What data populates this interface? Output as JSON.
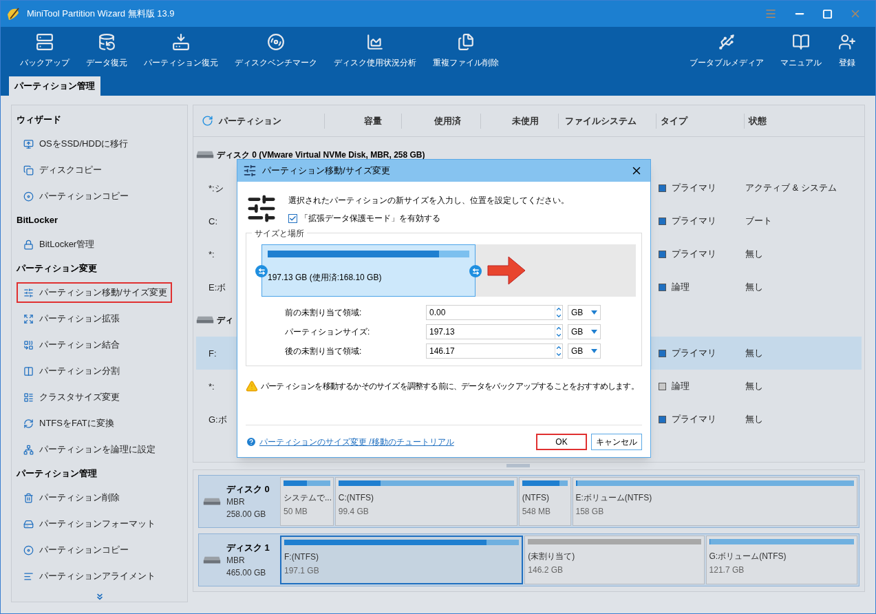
{
  "window": {
    "title": "MiniTool Partition Wizard 無料版 13.9"
  },
  "toolbar": {
    "left": [
      "バックアップ",
      "データ復元",
      "パーティション復元",
      "ディスクベンチマーク",
      "ディスク使用状況分析",
      "重複ファイル削除"
    ],
    "right": [
      "ブータブルメディア",
      "マニュアル",
      "登録"
    ]
  },
  "tabs": [
    {
      "label": "パーティション管理",
      "selected": true
    }
  ],
  "sidebar": {
    "sections": [
      {
        "title": "ウィザード",
        "items": [
          {
            "label": "OSをSSD/HDDに移行",
            "selected": false
          },
          {
            "label": "ディスクコピー",
            "selected": false
          },
          {
            "label": "パーティションコピー",
            "selected": false
          }
        ]
      },
      {
        "title": "BitLocker",
        "items": [
          {
            "label": "BitLocker管理",
            "selected": false
          }
        ]
      },
      {
        "title": "パーティション変更",
        "items": [
          {
            "label": "パーティション移動/サイズ変更",
            "selected": true
          },
          {
            "label": "パーティション拡張",
            "selected": false
          },
          {
            "label": "パーティション結合",
            "selected": false
          },
          {
            "label": "パーティション分割",
            "selected": false
          },
          {
            "label": "クラスタサイズ変更",
            "selected": false
          },
          {
            "label": "NTFSをFATに変換",
            "selected": false
          },
          {
            "label": "パーティションを論理に設定",
            "selected": false
          }
        ]
      },
      {
        "title": "パーティション管理",
        "items": [
          {
            "label": "パーティション削除",
            "selected": false
          },
          {
            "label": "パーティションフォーマット",
            "selected": false
          },
          {
            "label": "パーティションコピー",
            "selected": false
          },
          {
            "label": "パーティションアライメント",
            "selected": false
          }
        ]
      }
    ]
  },
  "table": {
    "columns": [
      "パーティション",
      "容量",
      "使用済",
      "未使用",
      "ファイルシステム",
      "タイプ",
      "状態"
    ],
    "groups": [
      {
        "disk": "ディスク 0 (VMware Virtual NVMe Disk, MBR, 258 GB)",
        "rows": [
          {
            "partition": "*:シ",
            "type": "プライマリ",
            "color": "#1f6fc0",
            "status": "アクティブ & システム",
            "selected": false
          },
          {
            "partition": "C:",
            "type": "プライマリ",
            "color": "#1f6fc0",
            "status": "ブート",
            "selected": false
          },
          {
            "partition": "*:",
            "type": "プライマリ",
            "color": "#1f6fc0",
            "status": "無し",
            "selected": false
          },
          {
            "partition": "E:ボ",
            "type": "論理",
            "color": "#1f6fc0",
            "status": "無し",
            "selected": false
          }
        ]
      },
      {
        "disk": "ディ",
        "rows": [
          {
            "partition": "F:",
            "type": "プライマリ",
            "color": "#1f6fc0",
            "status": "無し",
            "selected": true
          },
          {
            "partition": "*:",
            "type": "論理",
            "color": "#c8c8c8",
            "status": "無し",
            "selected": false
          },
          {
            "partition": "G:ボ",
            "type": "プライマリ",
            "color": "#1f6fc0",
            "status": "無し",
            "selected": false
          }
        ]
      }
    ]
  },
  "disk_map": [
    {
      "name": "ディスク 0",
      "scheme": "MBR",
      "size": "258.00 GB",
      "partitions": [
        {
          "kind": "partition",
          "label": "システムで...",
          "size": "50 MB",
          "level": 0.5,
          "color": "#1f7fd0",
          "selected": false
        },
        {
          "kind": "partition",
          "label": "C:(NTFS)",
          "size": "99.4 GB",
          "level": 0.24,
          "color": "#1f7fd0",
          "selected": false
        },
        {
          "kind": "partition",
          "label": "(NTFS)",
          "size": "548 MB",
          "level": 0.83,
          "color": "#1f7fd0",
          "selected": false
        },
        {
          "kind": "partition",
          "label": "E:ボリューム(NTFS)",
          "size": "158 GB",
          "level": 0.005,
          "color": "#1f7fd0",
          "selected": false
        }
      ]
    },
    {
      "name": "ディスク 1",
      "scheme": "MBR",
      "size": "465.00 GB",
      "partitions": [
        {
          "kind": "partition",
          "label": "F:(NTFS)",
          "size": "197.1 GB",
          "level": 0.86,
          "color": "#1f7fd0",
          "selected": true
        },
        {
          "kind": "unallocated",
          "label": "(未割り当て)",
          "size": "146.2 GB",
          "color": "#a8a8a8",
          "selected": false
        },
        {
          "kind": "partition",
          "label": "G:ボリューム(NTFS)",
          "size": "121.7 GB",
          "level": 0.005,
          "color": "#1f7fd0",
          "selected": false
        }
      ]
    }
  ],
  "dialog": {
    "title": "パーティション移動/サイズ変更",
    "message": "選択されたパーティションの新サイズを入力し、位置を設定してください。",
    "checkbox": {
      "label": "「拡張データ保護モード」を有効する",
      "checked": true
    },
    "group_title": "サイズと場所",
    "partition_block": {
      "text": "197.13 GB (使用済:168.10 GB)",
      "level": 0.85
    },
    "fields": [
      {
        "label": "前の未割り当て領域:",
        "value": "0.00",
        "unit": "GB"
      },
      {
        "label": "パーティションサイズ:",
        "value": "197.13",
        "unit": "GB"
      },
      {
        "label": "後の未割り当て領域:",
        "value": "146.17",
        "unit": "GB"
      }
    ],
    "warning": "パーティションを移動するかそのサイズを調整する前に、データをバックアップすることをおすすめします。",
    "help_link": "パーティションのサイズ変更 /移動のチュートリアル",
    "buttons": [
      {
        "label": "OK",
        "selected": true
      },
      {
        "label": "キャンセル",
        "selected": false
      }
    ]
  }
}
